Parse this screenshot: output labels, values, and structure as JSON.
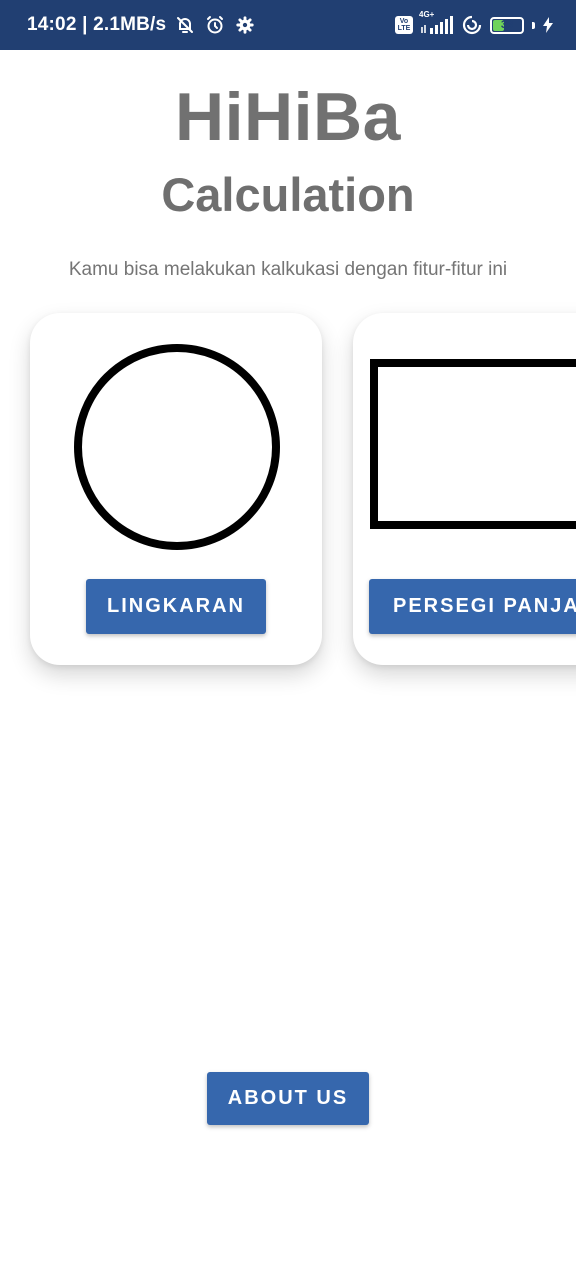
{
  "status_bar": {
    "time_speed": "14:02 | 2.1MB/s",
    "icons": [
      "bell-off-icon",
      "alarm-clock-icon",
      "settings-gear-icon",
      "volte-icon",
      "network-signal-icon",
      "data-saver-icon",
      "battery-icon",
      "charging-icon"
    ],
    "volte_line1": "Vo",
    "volte_line2": "LTE",
    "network_label": "4G+",
    "battery_level": "39",
    "battery_fraction": 0.39,
    "battery_fill_color": "#6fd35a",
    "background_color": "#213f72"
  },
  "header": {
    "title": "HiHiBa",
    "subtitle": "Calculation",
    "description": "Kamu bisa melakukan kalkukasi dengan fitur-fitur ini"
  },
  "features": [
    {
      "shape": "circle-shape",
      "button_label": "LINGKARAN"
    },
    {
      "shape": "rectangle-shape",
      "button_label": "PERSEGI PANJANG"
    }
  ],
  "footer": {
    "about_label": "ABOUT US"
  },
  "colors": {
    "primary_button": "#3667ad",
    "title_text": "#717171",
    "description_text": "#757575"
  }
}
